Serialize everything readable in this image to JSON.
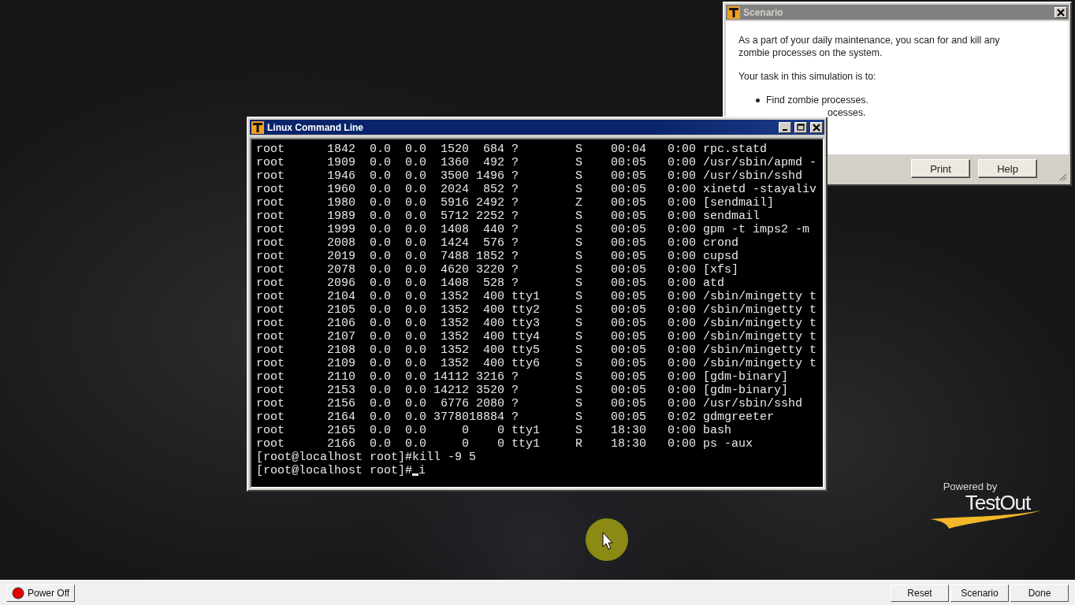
{
  "scenario_window": {
    "title": "Scenario",
    "paragraphs": [
      "As a part of your daily maintenance, you scan for and kill any zombie processes on the system.",
      "Your task in this simulation is to:"
    ],
    "tasks": [
      {
        "text": "Find zombie processes.",
        "partly_covered": false
      },
      {
        "text": "ocesses.",
        "partly_covered": true
      }
    ],
    "buttons": [
      "Print",
      "Help"
    ]
  },
  "terminal_window": {
    "title": "Linux Command Line",
    "lines": [
      "root      1842  0.0  0.0  1520  684 ?        S    00:04   0:00 rpc.statd",
      "root      1909  0.0  0.0  1360  492 ?        S    00:05   0:00 /usr/sbin/apmd -",
      "root      1946  0.0  0.0  3500 1496 ?        S    00:05   0:00 /usr/sbin/sshd",
      "root      1960  0.0  0.0  2024  852 ?        S    00:05   0:00 xinetd -stayaliv",
      "root      1980  0.0  0.0  5916 2492 ?        Z    00:05   0:00 [sendmail]",
      "root      1989  0.0  0.0  5712 2252 ?        S    00:05   0:00 sendmail",
      "root      1999  0.0  0.0  1408  440 ?        S    00:05   0:00 gpm -t imps2 -m",
      "root      2008  0.0  0.0  1424  576 ?        S    00:05   0:00 crond",
      "root      2019  0.0  0.0  7488 1852 ?        S    00:05   0:00 cupsd",
      "root      2078  0.0  0.0  4620 3220 ?        S    00:05   0:00 [xfs]",
      "root      2096  0.0  0.0  1408  528 ?        S    00:05   0:00 atd",
      "root      2104  0.0  0.0  1352  400 tty1     S    00:05   0:00 /sbin/mingetty t",
      "root      2105  0.0  0.0  1352  400 tty2     S    00:05   0:00 /sbin/mingetty t",
      "root      2106  0.0  0.0  1352  400 tty3     S    00:05   0:00 /sbin/mingetty t",
      "root      2107  0.0  0.0  1352  400 tty4     S    00:05   0:00 /sbin/mingetty t",
      "root      2108  0.0  0.0  1352  400 tty5     S    00:05   0:00 /sbin/mingetty t",
      "root      2109  0.0  0.0  1352  400 tty6     S    00:05   0:00 /sbin/mingetty t",
      "root      2110  0.0  0.0 14112 3216 ?        S    00:05   0:00 [gdm-binary]",
      "root      2153  0.0  0.0 14212 3520 ?        S    00:05   0:00 [gdm-binary]",
      "root      2156  0.0  0.0  6776 2080 ?        S    00:05   0:00 /usr/sbin/sshd",
      "root      2164  0.0  0.0 3778018884 ?        S    00:05   0:02 gdmgreeter",
      "root      2165  0.0  0.0     0    0 tty1     S    18:30   0:00 bash",
      "root      2166  0.0  0.0     0    0 tty1     R    18:30   0:00 ps -aux",
      "[root@localhost root]#kill -9 5"
    ],
    "prompt": "[root@localhost root]#",
    "typed": "i"
  },
  "logo": {
    "tagline": "Powered by",
    "name": "TestOut"
  },
  "taskbar": {
    "power_button": "Power Off",
    "buttons": [
      "Reset",
      "Scenario",
      "Done"
    ]
  }
}
